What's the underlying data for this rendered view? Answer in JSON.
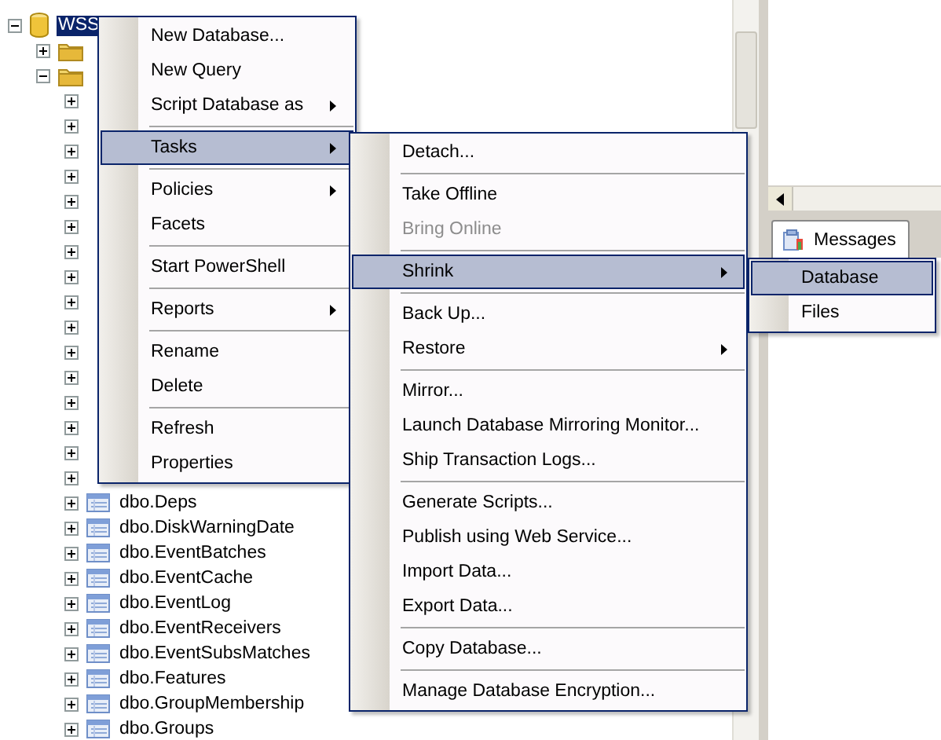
{
  "tree": [
    {
      "kind": "database",
      "label": "WSS",
      "expanded": true,
      "selected": true,
      "children": [
        {
          "kind": "folder",
          "expanded": false
        },
        {
          "kind": "folder",
          "expanded": true,
          "children": [
            {
              "kind": "table",
              "expanded": false
            },
            {
              "kind": "table",
              "expanded": false
            },
            {
              "kind": "table",
              "expanded": false
            },
            {
              "kind": "table",
              "expanded": false
            },
            {
              "kind": "table",
              "expanded": false
            },
            {
              "kind": "table",
              "expanded": false
            },
            {
              "kind": "table",
              "expanded": false
            },
            {
              "kind": "table",
              "expanded": false
            },
            {
              "kind": "table",
              "expanded": false
            },
            {
              "kind": "table",
              "expanded": false
            },
            {
              "kind": "table",
              "expanded": false
            },
            {
              "kind": "table",
              "expanded": false
            },
            {
              "kind": "table",
              "expanded": false
            },
            {
              "kind": "table",
              "expanded": false
            },
            {
              "kind": "table",
              "expanded": false
            },
            {
              "kind": "table",
              "expanded": false
            },
            {
              "kind": "table",
              "label": "dbo.Deps",
              "expanded": false
            },
            {
              "kind": "table",
              "label": "dbo.DiskWarningDate",
              "expanded": false
            },
            {
              "kind": "table",
              "label": "dbo.EventBatches",
              "expanded": false
            },
            {
              "kind": "table",
              "label": "dbo.EventCache",
              "expanded": false
            },
            {
              "kind": "table",
              "label": "dbo.EventLog",
              "expanded": false
            },
            {
              "kind": "table",
              "label": "dbo.EventReceivers",
              "expanded": false
            },
            {
              "kind": "table",
              "label": "dbo.EventSubsMatches",
              "expanded": false
            },
            {
              "kind": "table",
              "label": "dbo.Features",
              "expanded": false
            },
            {
              "kind": "table",
              "label": "dbo.GroupMembership",
              "expanded": false
            },
            {
              "kind": "table",
              "label": "dbo.Groups",
              "expanded": false
            }
          ]
        }
      ]
    }
  ],
  "result_tabs": [
    {
      "label": "Messages",
      "selected": true
    }
  ],
  "context_menu": {
    "items": [
      {
        "kind": "item",
        "label": "New Database...",
        "submenu": false,
        "selected": false,
        "disabled": false
      },
      {
        "kind": "item",
        "label": "New Query",
        "submenu": false,
        "selected": false,
        "disabled": false
      },
      {
        "kind": "item",
        "label": "Script Database as",
        "submenu": true,
        "selected": false,
        "disabled": false
      },
      {
        "kind": "separator"
      },
      {
        "kind": "item",
        "label": "Tasks",
        "submenu": true,
        "selected": true,
        "disabled": false
      },
      {
        "kind": "separator"
      },
      {
        "kind": "item",
        "label": "Policies",
        "submenu": true,
        "selected": false,
        "disabled": false
      },
      {
        "kind": "item",
        "label": "Facets",
        "submenu": false,
        "selected": false,
        "disabled": false
      },
      {
        "kind": "separator"
      },
      {
        "kind": "item",
        "label": "Start PowerShell",
        "submenu": false,
        "selected": false,
        "disabled": false
      },
      {
        "kind": "separator"
      },
      {
        "kind": "item",
        "label": "Reports",
        "submenu": true,
        "selected": false,
        "disabled": false
      },
      {
        "kind": "separator"
      },
      {
        "kind": "item",
        "label": "Rename",
        "submenu": false,
        "selected": false,
        "disabled": false
      },
      {
        "kind": "item",
        "label": "Delete",
        "submenu": false,
        "selected": false,
        "disabled": false
      },
      {
        "kind": "separator"
      },
      {
        "kind": "item",
        "label": "Refresh",
        "submenu": false,
        "selected": false,
        "disabled": false
      },
      {
        "kind": "item",
        "label": "Properties",
        "submenu": false,
        "selected": false,
        "disabled": false
      }
    ]
  },
  "tasks_menu": {
    "items": [
      {
        "kind": "item",
        "label": "Detach...",
        "submenu": false,
        "selected": false,
        "disabled": false
      },
      {
        "kind": "separator"
      },
      {
        "kind": "item",
        "label": "Take Offline",
        "submenu": false,
        "selected": false,
        "disabled": false
      },
      {
        "kind": "item",
        "label": "Bring Online",
        "submenu": false,
        "selected": false,
        "disabled": true
      },
      {
        "kind": "separator"
      },
      {
        "kind": "item",
        "label": "Shrink",
        "submenu": true,
        "selected": true,
        "disabled": false
      },
      {
        "kind": "separator"
      },
      {
        "kind": "item",
        "label": "Back Up...",
        "submenu": false,
        "selected": false,
        "disabled": false
      },
      {
        "kind": "item",
        "label": "Restore",
        "submenu": true,
        "selected": false,
        "disabled": false
      },
      {
        "kind": "separator"
      },
      {
        "kind": "item",
        "label": "Mirror...",
        "submenu": false,
        "selected": false,
        "disabled": false
      },
      {
        "kind": "item",
        "label": "Launch Database Mirroring Monitor...",
        "submenu": false,
        "selected": false,
        "disabled": false
      },
      {
        "kind": "item",
        "label": "Ship Transaction Logs...",
        "submenu": false,
        "selected": false,
        "disabled": false
      },
      {
        "kind": "separator"
      },
      {
        "kind": "item",
        "label": "Generate Scripts...",
        "submenu": false,
        "selected": false,
        "disabled": false
      },
      {
        "kind": "item",
        "label": "Publish using Web Service...",
        "submenu": false,
        "selected": false,
        "disabled": false
      },
      {
        "kind": "item",
        "label": "Import Data...",
        "submenu": false,
        "selected": false,
        "disabled": false
      },
      {
        "kind": "item",
        "label": "Export Data...",
        "submenu": false,
        "selected": false,
        "disabled": false
      },
      {
        "kind": "separator"
      },
      {
        "kind": "item",
        "label": "Copy Database...",
        "submenu": false,
        "selected": false,
        "disabled": false
      },
      {
        "kind": "separator"
      },
      {
        "kind": "item",
        "label": "Manage Database Encryption...",
        "submenu": false,
        "selected": false,
        "disabled": false
      }
    ]
  },
  "shrink_menu": {
    "items": [
      {
        "kind": "item",
        "label": "Database",
        "submenu": false,
        "selected": true,
        "disabled": false
      },
      {
        "kind": "item",
        "label": "Files",
        "submenu": false,
        "selected": false,
        "disabled": false
      }
    ]
  }
}
